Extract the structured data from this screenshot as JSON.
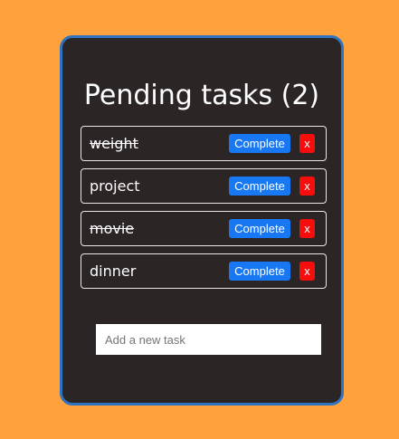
{
  "app": {
    "title": "Pending tasks (2)"
  },
  "tasks": [
    {
      "text": "weight",
      "completed": true,
      "complete_label": "Complete",
      "delete_label": "x"
    },
    {
      "text": "project",
      "completed": false,
      "complete_label": "Complete",
      "delete_label": "x"
    },
    {
      "text": "movie",
      "completed": true,
      "complete_label": "Complete",
      "delete_label": "x"
    },
    {
      "text": "dinner",
      "completed": false,
      "complete_label": "Complete",
      "delete_label": "x"
    }
  ],
  "new_task": {
    "placeholder": "Add a new task",
    "value": ""
  },
  "colors": {
    "background": "#ffa23d",
    "card": "#2b2526",
    "card_border": "#2f74c0",
    "complete_button": "#1877f2",
    "delete_button": "#f80d0d"
  }
}
